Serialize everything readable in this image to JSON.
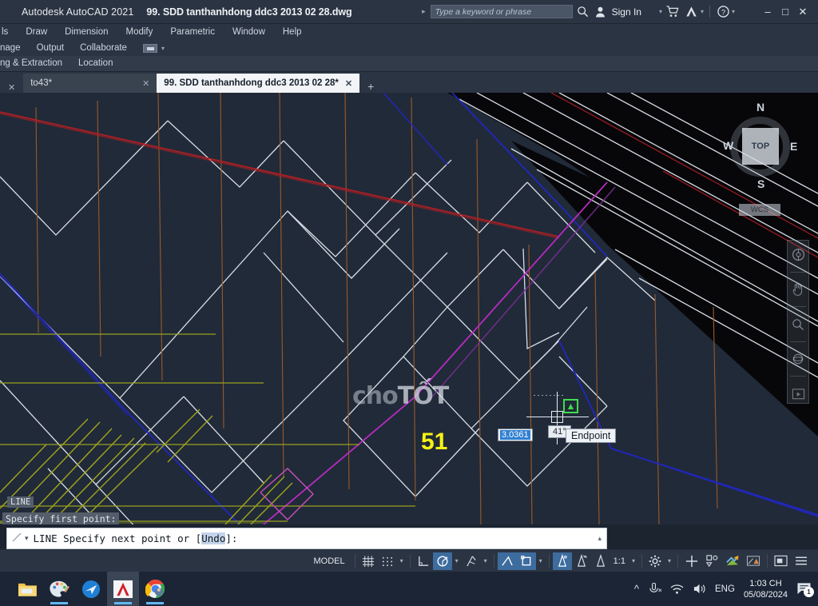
{
  "titlebar": {
    "app_name": "Autodesk AutoCAD 2021",
    "document_name": "99. SDD tanthanhdong ddc3 2013 02 28.dwg",
    "search_placeholder": "Type a keyword or phrase",
    "search_value": "",
    "sign_in_label": "Sign In",
    "icons": [
      "search-icon",
      "user-icon",
      "cart-icon",
      "autodesk-a-icon",
      "help-icon"
    ],
    "window_buttons": [
      "minimize",
      "maximize",
      "close"
    ],
    "doc_window_buttons": [
      "minimize",
      "restore",
      "close"
    ]
  },
  "menubar": {
    "items": [
      "ls",
      "Draw",
      "Dimension",
      "Modify",
      "Parametric",
      "Window",
      "Help"
    ]
  },
  "ribbon": {
    "row1": [
      "nage",
      "Output",
      "Collaborate"
    ],
    "row2": [
      "ng & Extraction",
      "Location"
    ]
  },
  "drawing_tabs": {
    "tabs": [
      {
        "label": "to43*",
        "active": false
      },
      {
        "label": "99. SDD tanthanhdong ddc3 2013 02 28*",
        "active": true
      }
    ],
    "new_tab_label": "+"
  },
  "canvas": {
    "background_color": "#212a38",
    "watermark_prefix": "cho",
    "watermark_suffix": "TỐT",
    "parcel_label": "51",
    "colors": {
      "white_line": "#d8dde5",
      "red_line": "#b21f24",
      "blue_line": "#2027b9",
      "orange_line": "#9a5a2a",
      "yellow_line": "#9aa01f",
      "magenta_line": "#b62bc2",
      "dark_region": "#07070a",
      "highlight_yellow": "#f6f216",
      "osnap_green": "#3fdc4f"
    },
    "dynamic_input": {
      "length_value": "3.0361",
      "angle_value": "41°",
      "osnap_tooltip": "Endpoint"
    },
    "prompt_overlay": {
      "command_tag": "LINE",
      "prompt_text": "Specify first point:"
    },
    "viewcube": {
      "face_label": "TOP",
      "north": "N",
      "south": "S",
      "east": "E",
      "west": "W",
      "ucs_label": "WCS"
    },
    "navbar_items": [
      "steering-wheels-icon",
      "pan-hand-icon",
      "zoom-extents-icon",
      "orbit-icon",
      "show-motion-icon"
    ]
  },
  "command_line": {
    "prefix": "LINE Specify next point or [",
    "option": "Undo",
    "suffix": "]:",
    "collapse_icon": "chevron-up-icon"
  },
  "statusbar": {
    "model_label": "MODEL",
    "scale_label": "1:1",
    "items": [
      {
        "name": "grid-display-toggle",
        "icon": "grid-icon",
        "on": false
      },
      {
        "name": "snap-mode-toggle",
        "icon": "snap-dots-icon",
        "on": false
      },
      {
        "name": "ortho-mode-toggle",
        "icon": "ortho-icon",
        "on": false
      },
      {
        "name": "polar-tracking-toggle",
        "icon": "polar-icon",
        "on": true
      },
      {
        "name": "isometric-drafting-toggle",
        "icon": "isoplane-icon",
        "on": false
      },
      {
        "name": "object-snap-tracking-toggle",
        "icon": "osnap-track-icon",
        "on": true
      },
      {
        "name": "object-snap-toggle",
        "icon": "object-snap-icon",
        "on": true
      },
      {
        "name": "lineweight-toggle",
        "icon": "lineweight-icon",
        "on": true
      },
      {
        "name": "transparency-toggle",
        "icon": "transparency-icon",
        "on": false
      },
      {
        "name": "selection-cycling-toggle",
        "icon": "selection-cycling-icon",
        "on": false
      },
      {
        "name": "annotation-visibility-toggle",
        "icon": "annotation-visibility-icon",
        "on": false
      },
      {
        "name": "autoscale-toggle",
        "icon": "autoscale-plus-icon",
        "on": false
      },
      {
        "name": "isolate-objects",
        "icon": "isolate-objects-icon",
        "on": false
      },
      {
        "name": "hardware-acceleration",
        "icon": "graphics-perf-icon",
        "on": false
      },
      {
        "name": "annotation-monitor",
        "icon": "annotation-monitor-icon",
        "on": false
      },
      {
        "name": "clean-screen-toggle",
        "icon": "clean-screen-icon",
        "on": false
      },
      {
        "name": "customization-menu",
        "icon": "hamburger-icon",
        "on": false
      }
    ]
  },
  "taskbar": {
    "apps": [
      {
        "name": "file-explorer",
        "icon": "folder-icon",
        "running": false
      },
      {
        "name": "paint",
        "icon": "paint-palette-icon",
        "running": true
      },
      {
        "name": "browser-blue",
        "icon": "blue-globe-icon",
        "running": false
      },
      {
        "name": "autocad",
        "icon": "autocad-a-icon",
        "running": true
      },
      {
        "name": "chrome",
        "icon": "chrome-icon",
        "running": true
      }
    ],
    "tray": {
      "overflow_icon": "chevron-up-icon",
      "mic_icon": "mic-muted-icon",
      "network_icon": "wifi-icon",
      "volume_icon": "speaker-icon",
      "language": "ENG",
      "time": "1:03 CH",
      "date": "05/08/2024",
      "notification_icon": "action-center-icon",
      "notification_count": "1"
    }
  }
}
